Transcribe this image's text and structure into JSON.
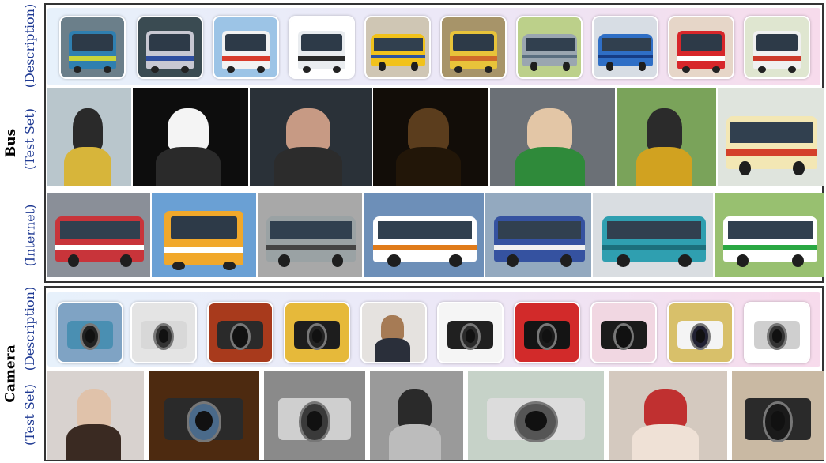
{
  "categories": [
    {
      "name": "Bus",
      "rows": [
        {
          "label_lines": [
            "(Description)"
          ]
        },
        {
          "label_lines": [
            "(Test Set)"
          ]
        },
        {
          "label_lines": [
            "(Internet)"
          ]
        }
      ]
    },
    {
      "name": "Camera",
      "rows": [
        {
          "label_lines": [
            "(Description)"
          ]
        },
        {
          "label_lines": [
            "(Test Set)"
          ]
        }
      ]
    }
  ]
}
